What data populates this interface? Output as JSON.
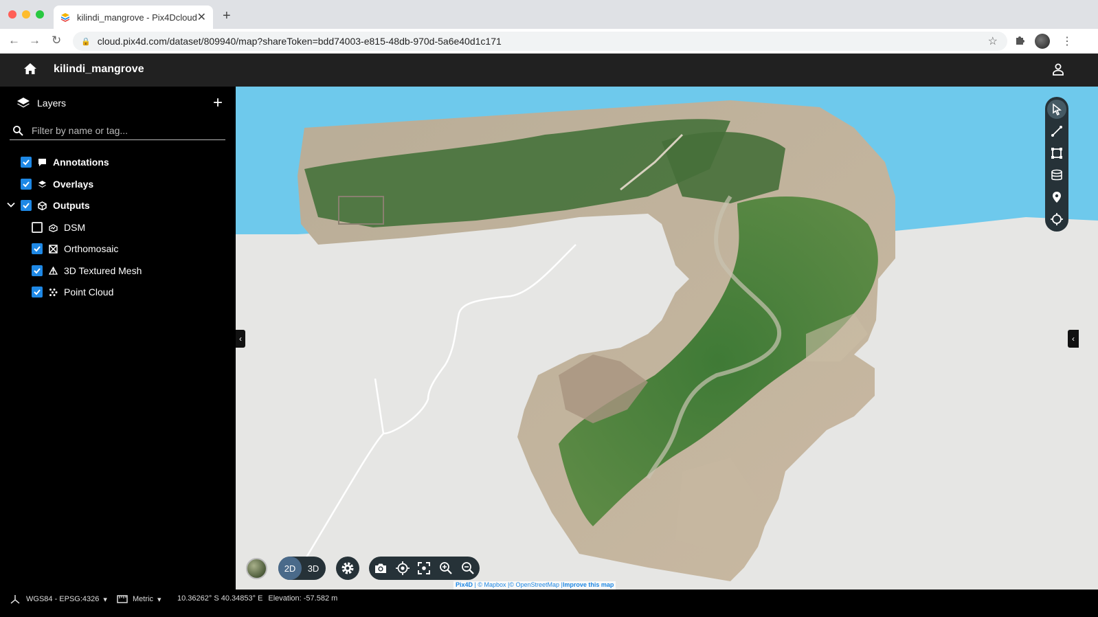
{
  "browser": {
    "tab_title": "kilindi_mangrove - Pix4Dcloud",
    "url": "cloud.pix4d.com/dataset/809940/map?shareToken=bdd74003-e815-48db-970d-5a6e40d1c171"
  },
  "app": {
    "project_name": "kilindi_mangrove"
  },
  "sidebar": {
    "header": "Layers",
    "filter_placeholder": "Filter by name or tag...",
    "layers": [
      {
        "label": "Annotations",
        "checked": true,
        "icon": "comment-icon"
      },
      {
        "label": "Overlays",
        "checked": true,
        "icon": "layers-icon"
      },
      {
        "label": "Outputs",
        "checked": true,
        "icon": "cube-icon",
        "expanded": true
      }
    ],
    "outputs": [
      {
        "label": "DSM",
        "checked": false,
        "icon": "dsm-icon"
      },
      {
        "label": "Orthomosaic",
        "checked": true,
        "icon": "orthomosaic-icon"
      },
      {
        "label": "3D Textured Mesh",
        "checked": true,
        "icon": "mesh-icon"
      },
      {
        "label": "Point Cloud",
        "checked": true,
        "icon": "point-cloud-icon"
      }
    ]
  },
  "map_controls": {
    "view_2d": "2D",
    "view_3d": "3D",
    "active_view": "2D"
  },
  "attribution": {
    "pix4d": "Pix4D",
    "mapbox": " | © Mapbox |",
    "osm": "© OpenStreetMap |",
    "improve": "Improve this map"
  },
  "status_bar": {
    "crs": "WGS84 - EPSG:4326",
    "units": "Metric",
    "coordinates": "10.36262° S 40.34853° E",
    "elevation": "Elevation: -57.582 m"
  },
  "colors": {
    "accent": "#1e88e5",
    "water": "#6ec9ec",
    "land": "#e6e6e4",
    "tool_panel": "#263238"
  }
}
